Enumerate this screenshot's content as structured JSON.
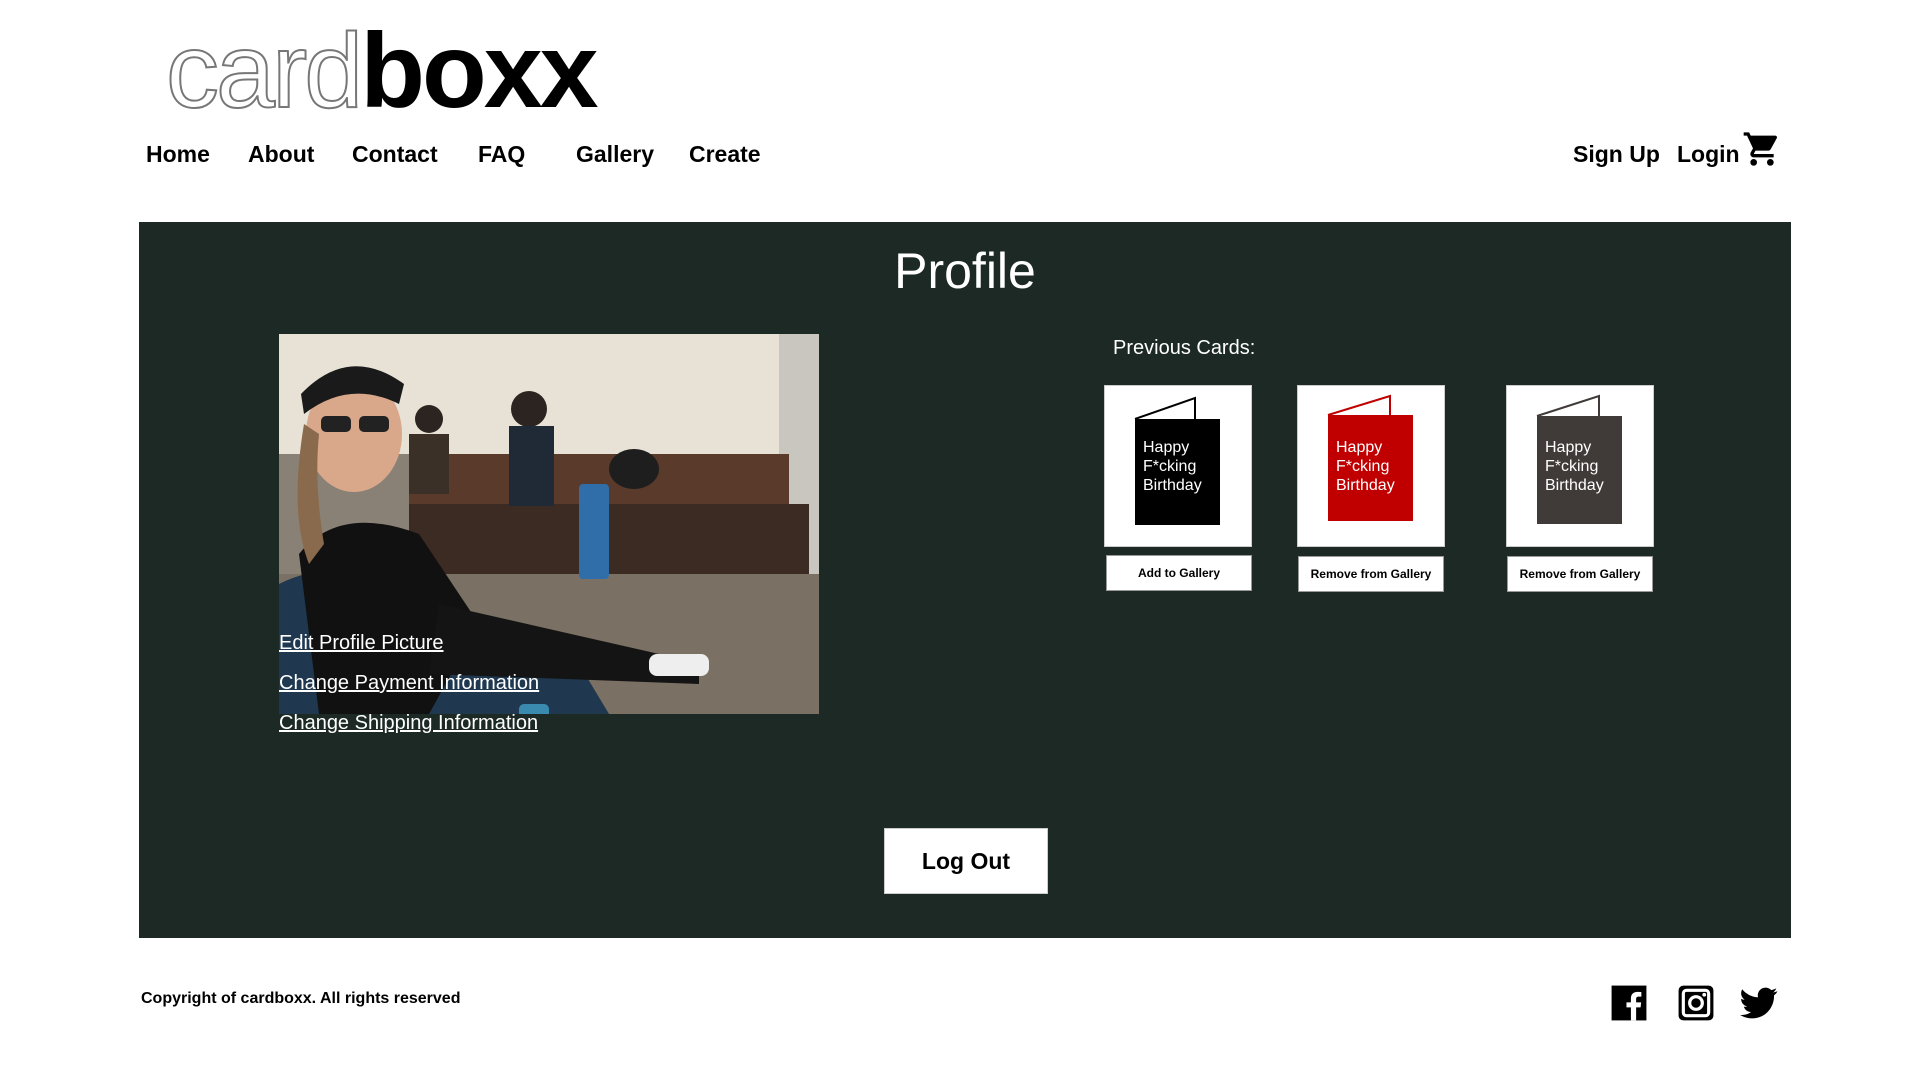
{
  "brand": {
    "part1": "card",
    "part2": "boxx"
  },
  "nav": {
    "items": [
      "Home",
      "About",
      "Contact",
      "FAQ",
      "Gallery",
      "Create"
    ]
  },
  "auth": {
    "signup": "Sign Up",
    "login": "Login",
    "cart_icon": "cart-icon"
  },
  "profile": {
    "title": "Profile",
    "links": [
      "Edit Profile Picture",
      "Change Payment Information",
      "Change Shipping Information"
    ],
    "previous_label": "Previous Cards:",
    "cards": [
      {
        "text": "Happy F*cking Birthday",
        "color": "#000000",
        "button": "Add to Gallery"
      },
      {
        "text": "Happy F*cking Birthday",
        "color": "#c00000",
        "button": "Remove from Gallery"
      },
      {
        "text": "Happy F*cking Birthday",
        "color": "#403a38",
        "button": "Remove from Gallery"
      }
    ],
    "logout": "Log Out"
  },
  "footer": {
    "copyright": "Copyright of cardboxx. All rights reserved",
    "social": [
      "facebook-icon",
      "instagram-icon",
      "twitter-icon"
    ]
  },
  "colors": {
    "panel": "#1c2925"
  }
}
